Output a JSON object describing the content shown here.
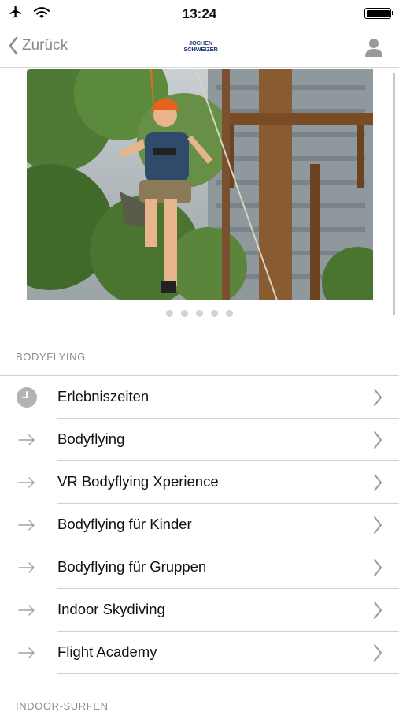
{
  "status_bar": {
    "time": "13:24"
  },
  "nav": {
    "back_label": "Zurück",
    "logo_line1": "JOCHEN",
    "logo_line2": "SCHWEIZER"
  },
  "carousel": {
    "page_count": 5,
    "active_index": 0
  },
  "sections": [
    {
      "title": "BODYFLYING",
      "items": [
        {
          "label": "Erlebniszeiten",
          "icon": "clock-icon"
        },
        {
          "label": "Bodyflying",
          "icon": "arrow-right-icon"
        },
        {
          "label": "VR Bodyflying Xperience",
          "icon": "arrow-right-icon"
        },
        {
          "label": "Bodyflying für Kinder",
          "icon": "arrow-right-icon"
        },
        {
          "label": "Bodyflying für Gruppen",
          "icon": "arrow-right-icon"
        },
        {
          "label": "Indoor Skydiving",
          "icon": "arrow-right-icon"
        },
        {
          "label": "Flight Academy",
          "icon": "arrow-right-icon"
        }
      ]
    },
    {
      "title": "INDOOR-SURFEN",
      "items": []
    }
  ]
}
